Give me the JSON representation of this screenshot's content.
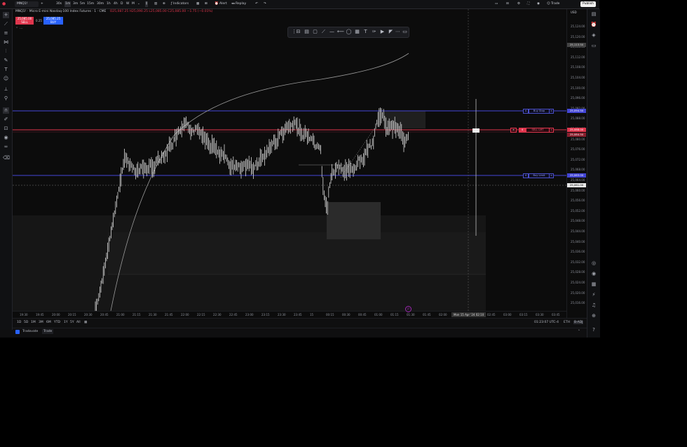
{
  "topbar": {
    "symbol": "MNQ1!",
    "timeframes": [
      "30s",
      "1m",
      "3m",
      "5m",
      "15m",
      "30m",
      "1h",
      "4h",
      "D",
      "W",
      "M"
    ],
    "indicators_label": "Indicators",
    "alert_label": "Alert",
    "replay_label": "Replay",
    "trade_label": "Trade",
    "publish_label": "Publish"
  },
  "legend": {
    "title": "MNQ1! · Micro E-mini Nasdaq-100 Index Futures · 1 · CME",
    "ohlc": "O25,087.25 H25,090.25 L25,085.00 C25,085.00 −1.75 (−0.01%)",
    "sell_price": "25,085.00",
    "sell_label": "SELL",
    "spread": "0.25",
    "buy_price": "25,085.25",
    "buy_label": "BUY"
  },
  "price_axis": {
    "currency": "USD",
    "labels": [
      "25,124.00",
      "25,120.00",
      "25,116.00",
      "25,112.00",
      "25,108.00",
      "25,104.00",
      "25,100.00",
      "25,096.00",
      "25,092.00",
      "25,088.00",
      "25,084.00",
      "25,080.00",
      "25,076.00",
      "25,072.00",
      "25,068.00",
      "25,064.00",
      "25,060.00",
      "25,056.00",
      "25,052.00",
      "25,048.00",
      "25,044.00",
      "25,040.00",
      "25,036.00",
      "25,032.00",
      "25,028.00",
      "25,024.00",
      "25,020.00",
      "25,016.00"
    ],
    "tag_top": "25,113.50",
    "tag_blue_upper": "25,094.50",
    "tag_red": "25,088.00",
    "tag_red_lower": "25,084.50",
    "tag_blue_lower": "25,063.00",
    "tag_current": "25,061.00"
  },
  "orders": {
    "buy_stop_label": "Buy Stop",
    "buy_stop_qty": "4",
    "sell_label": "SELL LMT",
    "sell_qty": "4",
    "buy_limit_label": "Buy Limit",
    "buy_limit_qty": "4"
  },
  "time_axis": {
    "labels": [
      "19:30",
      "19:45",
      "20:00",
      "20:15",
      "20:30",
      "20:45",
      "21:00",
      "21:15",
      "21:30",
      "21:45",
      "22:00",
      "22:15",
      "22:30",
      "22:45",
      "23:00",
      "23:15",
      "23:30",
      "23:45",
      "15",
      "00:15",
      "00:30",
      "00:45",
      "01:00",
      "01:15",
      "01:30",
      "01:45",
      "02:00",
      "02:15",
      "02:30",
      "02:45",
      "03:00",
      "03:15",
      "03:30",
      "03:45"
    ],
    "crosshair_time": "Mon 15 Apr '24  02:10"
  },
  "bottom_bar": {
    "ranges": [
      "1D",
      "5D",
      "1M",
      "3M",
      "6M",
      "YTD",
      "1Y",
      "5Y",
      "All"
    ],
    "clock": "01:23:07 UTC-4",
    "session": "ETH",
    "adj": "B-ADJ"
  },
  "trade_bar": {
    "broker": "Tradovate",
    "tab": "Trade"
  },
  "colors": {
    "accent_blue": "#2962ff",
    "sell_red": "#e0364d",
    "candle": "#d9d9d9"
  }
}
